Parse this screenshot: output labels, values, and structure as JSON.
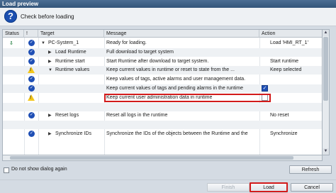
{
  "window": {
    "title": "Load preview"
  },
  "header": {
    "text": "Check before loading",
    "icon": "help-icon"
  },
  "columns": {
    "status": "Status",
    "bang": "!",
    "target": "Target",
    "message": "Message",
    "action": "Action"
  },
  "rows": [
    {
      "status_icon": "load-icon",
      "state": "ok",
      "indent": 0,
      "expander": "▼",
      "target": "PC-System_1",
      "message": "Ready for loading.",
      "action": "Load 'HMI_RT_1'"
    },
    {
      "status_icon": "",
      "state": "ok",
      "indent": 1,
      "expander": "▶",
      "target": "Load Runtime",
      "message": "Full download to target system",
      "action": ""
    },
    {
      "status_icon": "",
      "state": "ok",
      "indent": 1,
      "expander": "▶",
      "target": "Runtime start",
      "message": "Start Runtime after download to target system.",
      "action": "Start runtime"
    },
    {
      "status_icon": "",
      "state": "warn",
      "indent": 1,
      "expander": "▼",
      "target": "Runtime values",
      "message": "Keep current values in runtime or reset to state from the ...",
      "action": "Keep selected"
    },
    {
      "status_icon": "",
      "state": "ok",
      "indent": 2,
      "expander": "",
      "target": "",
      "message": "Keep values of tags, active alarms and user management data.",
      "action": ""
    },
    {
      "status_icon": "",
      "state": "ok",
      "indent": 2,
      "expander": "",
      "target": "",
      "message": "Keep current values of tags and pending alarms in the runtime",
      "action": "",
      "checkbox": "checked"
    },
    {
      "status_icon": "",
      "state": "warn",
      "indent": 2,
      "expander": "",
      "target": "",
      "message": "Keep current user administration data in runtime",
      "action": "",
      "checkbox": "unchecked",
      "highlight": true
    },
    {
      "status_icon": "",
      "state": "",
      "indent": 0,
      "expander": "",
      "target": "",
      "message": "",
      "action": ""
    },
    {
      "status_icon": "",
      "state": "ok",
      "indent": 1,
      "expander": "▶",
      "target": "Reset logs",
      "message": "Reset all logs in the runtime",
      "action": "No reset"
    },
    {
      "status_icon": "",
      "state": "",
      "indent": 0,
      "expander": "",
      "target": "",
      "message": "",
      "action": ""
    },
    {
      "status_icon": "",
      "state": "ok",
      "indent": 1,
      "expander": "▶",
      "target": "Synchronize IDs",
      "message": "Synchronize the IDs of the objects between the Runtime and the",
      "action": "Synchronize"
    }
  ],
  "footer": {
    "dont_show_label": "Do not show dialog again",
    "refresh_label": "Refresh",
    "finish_label": "Finish",
    "load_label": "Load",
    "cancel_label": "Cancel"
  },
  "colors": {
    "accent": "#1f4fb5",
    "warning": "#f3c61a",
    "highlight": "#d21b1b",
    "titlebar": "#3b5f86"
  }
}
